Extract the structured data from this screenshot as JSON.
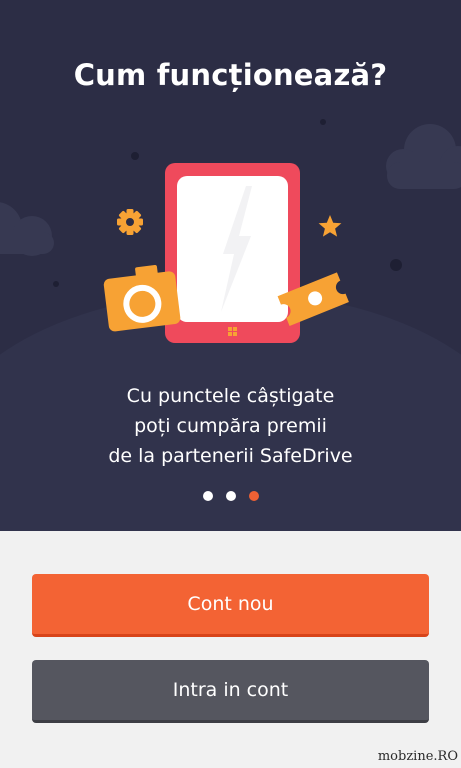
{
  "onboarding": {
    "title": "Cum funcționează?",
    "caption_lines": [
      "Cu punctele câștigate",
      "poți cumpăra premii",
      "de la partenerii SafeDrive"
    ],
    "page_indicator": {
      "total": 3,
      "current": 3
    }
  },
  "actions": {
    "create_account_label": "Cont nou",
    "login_label": "Intra in cont"
  },
  "watermark": "mobzine.RO",
  "icons": [
    "cloud-icon",
    "phone-icon",
    "camera-icon",
    "ticket-icon",
    "gear-icon",
    "star-icon"
  ],
  "colors": {
    "hero_background": "#2c2d45",
    "accent": "#f36334",
    "phone_frame": "#ef4a5c",
    "illustration_orange": "#f7a234",
    "secondary_button": "#55565f"
  }
}
